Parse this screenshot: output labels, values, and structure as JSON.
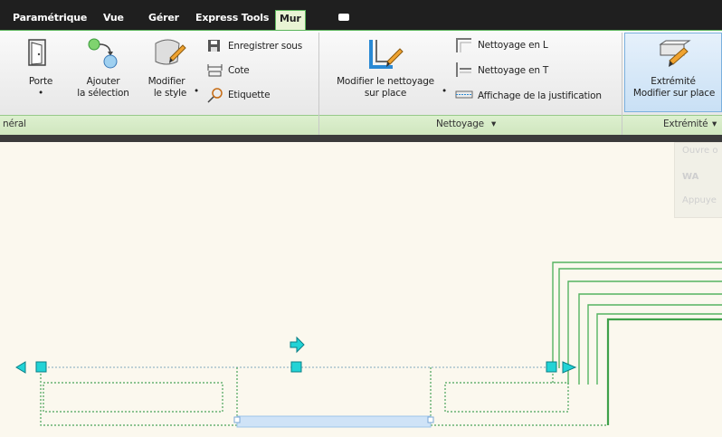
{
  "tabs": [
    {
      "label": "Paramétrique"
    },
    {
      "label": "Vue"
    },
    {
      "label": "Gérer"
    },
    {
      "label": "Express Tools"
    },
    {
      "label": "Mur"
    }
  ],
  "ribbon": {
    "general": {
      "porte": "Porte",
      "ajouter_1": "Ajouter",
      "ajouter_2": "la sélection",
      "modifier_1": "Modifier",
      "modifier_2": "le style",
      "enregistrer": "Enregistrer sous",
      "cote": "Cote",
      "etiquette": "Etiquette",
      "title": "néral"
    },
    "nettoyage": {
      "modifier_1": "Modifier le nettoyage",
      "modifier_2": "sur place",
      "nettoyage_l": "Nettoyage en L",
      "nettoyage_t": "Nettoyage en T",
      "affichage": "Affichage de la justification",
      "title": "Nettoyage"
    },
    "extremite": {
      "label_1": "Extrémité",
      "label_2": "Modifier sur place",
      "title": "Extrémité"
    }
  },
  "ghost_tooltip": {
    "line1": "Ouvre o",
    "line2": "WA",
    "line3": "Appuye"
  },
  "colors": {
    "ribbon_accent": "#5bb55b",
    "canvas": "#fbf8ee",
    "grip": "#22d3d6",
    "wall_line": "#3fa14a"
  }
}
